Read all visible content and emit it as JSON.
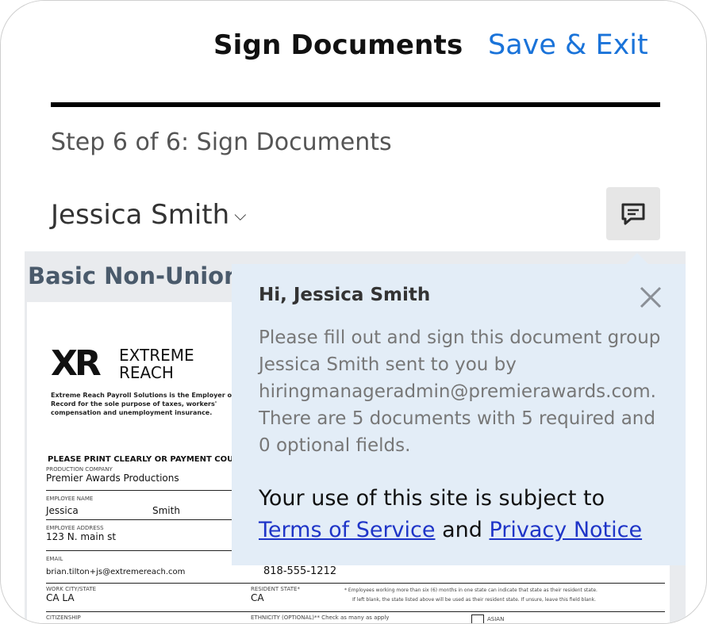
{
  "header": {
    "title": "Sign Documents",
    "save_exit": "Save & Exit"
  },
  "step": "Step 6 of 6: Sign Documents",
  "user": {
    "name": "Jessica Smith"
  },
  "document": {
    "title": "Basic Non-Union",
    "logo_mark": "XR",
    "logo_line1": "EXTREME",
    "logo_line2": "REACH",
    "employer_note": "Extreme Reach Payroll Solutions is the Employer of Record for the sole purpose of taxes, workers' compensation and unemployment insurance.",
    "print_heading": "PLEASE PRINT CLEARLY OR PAYMENT COU",
    "fields": [
      {
        "label": "PRODUCTION COMPANY",
        "value": "Premier Awards Productions"
      },
      {
        "label": "EMPLOYEE NAME",
        "value": "Jessica",
        "value2": "Smith"
      },
      {
        "label": "EMPLOYEE ADDRESS",
        "value": "123 N. main st"
      },
      {
        "label": "EMAIL",
        "value": "brian.tilton+js@extremereach.com",
        "value2": "818-555-1212"
      },
      {
        "label": "WORK CITY/STATE",
        "value": "CA LA",
        "label2": "RESIDENT STATE*",
        "value2": "CA",
        "note": "* Employees working more than six (6) months in one state can indicate that state as their resident state.",
        "note2": "If left blank, the state listed above will be used as their resident state. If unsure, leave this field blank."
      },
      {
        "label": "CITIZENSHIP",
        "label2": "ETHNICITY (OPTIONAL)** Check as many as apply",
        "check_label": "ASIAN"
      }
    ]
  },
  "popover": {
    "greeting": "Hi, Jessica Smith",
    "message": "Please fill out and sign this document group Jessica Smith sent to you by hiringmanageradmin@premierawards.com. There are 5 documents with 5 required and 0 optional fields.",
    "terms_prefix": "Your use of this site is subject to",
    "terms_link": "Terms of Service",
    "terms_and": "and",
    "privacy_link": "Privacy Notice"
  },
  "icons": {
    "chat": "chat-bubble-icon",
    "close": "close-icon",
    "chevron": "chevron-down-icon"
  },
  "colors": {
    "link": "#1a73d9",
    "popover_bg": "#e3edf7",
    "doc_bg": "#e9ebee"
  }
}
